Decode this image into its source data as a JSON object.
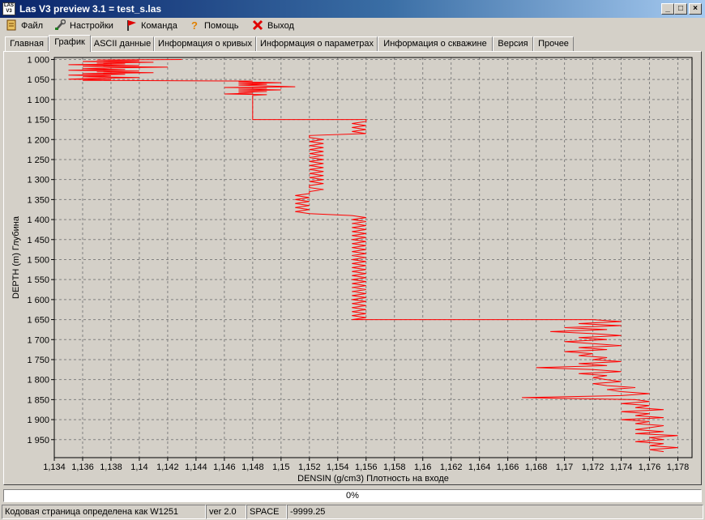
{
  "window": {
    "title": "Las V3 preview 3.1 = test_s.las",
    "app_icon_text": "LAS V3",
    "buttons": {
      "minimize": "_",
      "maximize": "□",
      "close": "×"
    }
  },
  "menu": [
    {
      "label": "Файл",
      "icon": "file-icon"
    },
    {
      "label": "Настройки",
      "icon": "settings-wrench-icon"
    },
    {
      "label": "Команда",
      "icon": "red-flag-icon"
    },
    {
      "label": "Помощь",
      "icon": "question-mark-icon"
    },
    {
      "label": "Выход",
      "icon": "exit-x-icon"
    }
  ],
  "tabs": [
    {
      "label": "Главная",
      "active": false
    },
    {
      "label": "График",
      "active": true
    },
    {
      "label": "ASCII данные",
      "active": false
    },
    {
      "label": "Информация о кривых",
      "active": false
    },
    {
      "label": "Информация о параметрах",
      "active": false
    },
    {
      "label": "Информация о скважине",
      "active": false
    },
    {
      "label": "Версия",
      "active": false
    },
    {
      "label": "Прочее",
      "active": false
    }
  ],
  "chart_data": {
    "type": "line",
    "orientation": "depth-down",
    "xlabel": "DENSIN (g/cm3) Плотность на входе",
    "ylabel": "DEPTH (m) Глубина",
    "xlim": [
      1.134,
      1.179
    ],
    "ylim": [
      995,
      1995
    ],
    "x_ticks": [
      "1,134",
      "1,136",
      "1,138",
      "1,14",
      "1,142",
      "1,144",
      "1,146",
      "1,148",
      "1,15",
      "1,152",
      "1,154",
      "1,156",
      "1,158",
      "1,16",
      "1,162",
      "1,164",
      "1,166",
      "1,168",
      "1,17",
      "1,172",
      "1,174",
      "1,176",
      "1,178"
    ],
    "x_tick_values": [
      1.134,
      1.136,
      1.138,
      1.14,
      1.142,
      1.144,
      1.146,
      1.148,
      1.15,
      1.152,
      1.154,
      1.156,
      1.158,
      1.16,
      1.162,
      1.164,
      1.166,
      1.168,
      1.17,
      1.172,
      1.174,
      1.176,
      1.178
    ],
    "y_ticks": [
      "1 000",
      "1 050",
      "1 100",
      "1 150",
      "1 200",
      "1 250",
      "1 300",
      "1 350",
      "1 400",
      "1 450",
      "1 500",
      "1 550",
      "1 600",
      "1 650",
      "1 700",
      "1 750",
      "1 800",
      "1 850",
      "1 900",
      "1 950"
    ],
    "y_tick_values": [
      1000,
      1050,
      1100,
      1150,
      1200,
      1250,
      1300,
      1350,
      1400,
      1450,
      1500,
      1550,
      1600,
      1650,
      1700,
      1750,
      1800,
      1850,
      1900,
      1950
    ],
    "grid": true,
    "series": [
      {
        "color": "#ff0000",
        "points": [
          [
            1000,
            1.143
          ],
          [
            1001,
            1.137
          ],
          [
            1003,
            1.14
          ],
          [
            1005,
            1.136
          ],
          [
            1007,
            1.141
          ],
          [
            1009,
            1.137
          ],
          [
            1011,
            1.139
          ],
          [
            1013,
            1.135
          ],
          [
            1015,
            1.14
          ],
          [
            1017,
            1.136
          ],
          [
            1019,
            1.142
          ],
          [
            1021,
            1.138
          ],
          [
            1023,
            1.136
          ],
          [
            1025,
            1.139
          ],
          [
            1027,
            1.135
          ],
          [
            1029,
            1.14
          ],
          [
            1031,
            1.137
          ],
          [
            1033,
            1.141
          ],
          [
            1035,
            1.136
          ],
          [
            1037,
            1.139
          ],
          [
            1039,
            1.135
          ],
          [
            1041,
            1.138
          ],
          [
            1043,
            1.136
          ],
          [
            1045,
            1.14
          ],
          [
            1047,
            1.137
          ],
          [
            1049,
            1.135
          ],
          [
            1050,
            1.138
          ],
          [
            1052,
            1.136
          ],
          [
            1054,
            1.148
          ],
          [
            1056,
            1.147
          ],
          [
            1058,
            1.15
          ],
          [
            1060,
            1.147
          ],
          [
            1062,
            1.149
          ],
          [
            1064,
            1.147
          ],
          [
            1066,
            1.149
          ],
          [
            1068,
            1.151
          ],
          [
            1070,
            1.146
          ],
          [
            1072,
            1.149
          ],
          [
            1074,
            1.147
          ],
          [
            1076,
            1.15
          ],
          [
            1078,
            1.147
          ],
          [
            1080,
            1.149
          ],
          [
            1082,
            1.147
          ],
          [
            1084,
            1.148
          ],
          [
            1086,
            1.146
          ],
          [
            1088,
            1.149
          ],
          [
            1090,
            1.148
          ],
          [
            1150,
            1.148
          ],
          [
            1150,
            1.156
          ],
          [
            1155,
            1.156
          ],
          [
            1160,
            1.155
          ],
          [
            1165,
            1.156
          ],
          [
            1170,
            1.155
          ],
          [
            1175,
            1.156
          ],
          [
            1180,
            1.155
          ],
          [
            1185,
            1.156
          ],
          [
            1190,
            1.152
          ],
          [
            1195,
            1.152
          ],
          [
            1200,
            1.153
          ],
          [
            1205,
            1.152
          ],
          [
            1210,
            1.153
          ],
          [
            1215,
            1.152
          ],
          [
            1220,
            1.153
          ],
          [
            1225,
            1.152
          ],
          [
            1230,
            1.153
          ],
          [
            1235,
            1.152
          ],
          [
            1240,
            1.153
          ],
          [
            1245,
            1.152
          ],
          [
            1250,
            1.153
          ],
          [
            1255,
            1.152
          ],
          [
            1260,
            1.153
          ],
          [
            1265,
            1.152
          ],
          [
            1270,
            1.153
          ],
          [
            1275,
            1.152
          ],
          [
            1280,
            1.153
          ],
          [
            1285,
            1.152
          ],
          [
            1290,
            1.153
          ],
          [
            1295,
            1.152
          ],
          [
            1300,
            1.153
          ],
          [
            1305,
            1.152
          ],
          [
            1310,
            1.153
          ],
          [
            1315,
            1.152
          ],
          [
            1320,
            1.152
          ],
          [
            1325,
            1.153
          ],
          [
            1330,
            1.152
          ],
          [
            1335,
            1.152
          ],
          [
            1340,
            1.151
          ],
          [
            1345,
            1.152
          ],
          [
            1350,
            1.151
          ],
          [
            1355,
            1.152
          ],
          [
            1360,
            1.151
          ],
          [
            1365,
            1.152
          ],
          [
            1370,
            1.151
          ],
          [
            1375,
            1.152
          ],
          [
            1380,
            1.151
          ],
          [
            1385,
            1.152
          ],
          [
            1390,
            1.155
          ],
          [
            1395,
            1.156
          ],
          [
            1400,
            1.155
          ],
          [
            1405,
            1.156
          ],
          [
            1410,
            1.155
          ],
          [
            1415,
            1.156
          ],
          [
            1420,
            1.155
          ],
          [
            1425,
            1.156
          ],
          [
            1430,
            1.155
          ],
          [
            1435,
            1.156
          ],
          [
            1440,
            1.155
          ],
          [
            1445,
            1.156
          ],
          [
            1450,
            1.155
          ],
          [
            1455,
            1.156
          ],
          [
            1460,
            1.155
          ],
          [
            1465,
            1.156
          ],
          [
            1470,
            1.155
          ],
          [
            1475,
            1.156
          ],
          [
            1480,
            1.155
          ],
          [
            1485,
            1.156
          ],
          [
            1490,
            1.155
          ],
          [
            1495,
            1.156
          ],
          [
            1500,
            1.155
          ],
          [
            1505,
            1.156
          ],
          [
            1510,
            1.155
          ],
          [
            1515,
            1.156
          ],
          [
            1520,
            1.155
          ],
          [
            1525,
            1.156
          ],
          [
            1530,
            1.155
          ],
          [
            1535,
            1.156
          ],
          [
            1540,
            1.155
          ],
          [
            1545,
            1.156
          ],
          [
            1550,
            1.155
          ],
          [
            1555,
            1.156
          ],
          [
            1560,
            1.155
          ],
          [
            1565,
            1.156
          ],
          [
            1570,
            1.155
          ],
          [
            1575,
            1.156
          ],
          [
            1580,
            1.155
          ],
          [
            1585,
            1.156
          ],
          [
            1590,
            1.155
          ],
          [
            1595,
            1.156
          ],
          [
            1600,
            1.155
          ],
          [
            1605,
            1.156
          ],
          [
            1610,
            1.155
          ],
          [
            1615,
            1.156
          ],
          [
            1620,
            1.155
          ],
          [
            1625,
            1.156
          ],
          [
            1630,
            1.155
          ],
          [
            1635,
            1.156
          ],
          [
            1640,
            1.155
          ],
          [
            1645,
            1.156
          ],
          [
            1650,
            1.155
          ],
          [
            1650,
            1.172
          ],
          [
            1655,
            1.174
          ],
          [
            1660,
            1.171
          ],
          [
            1665,
            1.174
          ],
          [
            1670,
            1.17
          ],
          [
            1675,
            1.173
          ],
          [
            1680,
            1.169
          ],
          [
            1685,
            1.172
          ],
          [
            1690,
            1.174
          ],
          [
            1695,
            1.171
          ],
          [
            1700,
            1.173
          ],
          [
            1705,
            1.17
          ],
          [
            1710,
            1.172
          ],
          [
            1715,
            1.174
          ],
          [
            1720,
            1.171
          ],
          [
            1725,
            1.173
          ],
          [
            1730,
            1.17
          ],
          [
            1735,
            1.172
          ],
          [
            1740,
            1.171
          ],
          [
            1745,
            1.173
          ],
          [
            1750,
            1.172
          ],
          [
            1755,
            1.174
          ],
          [
            1760,
            1.171
          ],
          [
            1765,
            1.173
          ],
          [
            1770,
            1.168
          ],
          [
            1775,
            1.172
          ],
          [
            1780,
            1.174
          ],
          [
            1785,
            1.171
          ],
          [
            1790,
            1.173
          ],
          [
            1795,
            1.172
          ],
          [
            1800,
            1.173
          ],
          [
            1805,
            1.174
          ],
          [
            1810,
            1.172
          ],
          [
            1815,
            1.173
          ],
          [
            1820,
            1.175
          ],
          [
            1825,
            1.173
          ],
          [
            1830,
            1.174
          ],
          [
            1835,
            1.176
          ],
          [
            1840,
            1.174
          ],
          [
            1845,
            1.167
          ],
          [
            1850,
            1.175
          ],
          [
            1855,
            1.176
          ],
          [
            1860,
            1.174
          ],
          [
            1865,
            1.176
          ],
          [
            1870,
            1.175
          ],
          [
            1875,
            1.177
          ],
          [
            1880,
            1.174
          ],
          [
            1885,
            1.176
          ],
          [
            1890,
            1.175
          ],
          [
            1895,
            1.177
          ],
          [
            1900,
            1.174
          ],
          [
            1905,
            1.176
          ],
          [
            1910,
            1.175
          ],
          [
            1915,
            1.177
          ],
          [
            1920,
            1.176
          ],
          [
            1925,
            1.175
          ],
          [
            1930,
            1.177
          ],
          [
            1935,
            1.175
          ],
          [
            1940,
            1.178
          ],
          [
            1945,
            1.176
          ],
          [
            1950,
            1.177
          ],
          [
            1955,
            1.175
          ],
          [
            1960,
            1.177
          ],
          [
            1965,
            1.176
          ],
          [
            1970,
            1.178
          ],
          [
            1975,
            1.176
          ],
          [
            1980,
            1.177
          ]
        ]
      }
    ]
  },
  "progress": {
    "text": "0%",
    "value": 0
  },
  "status": {
    "codepage": "Кодовая страница определена как W1251",
    "version": "ver 2.0",
    "delimiter": "SPACE",
    "null_value": "-9999.25"
  }
}
